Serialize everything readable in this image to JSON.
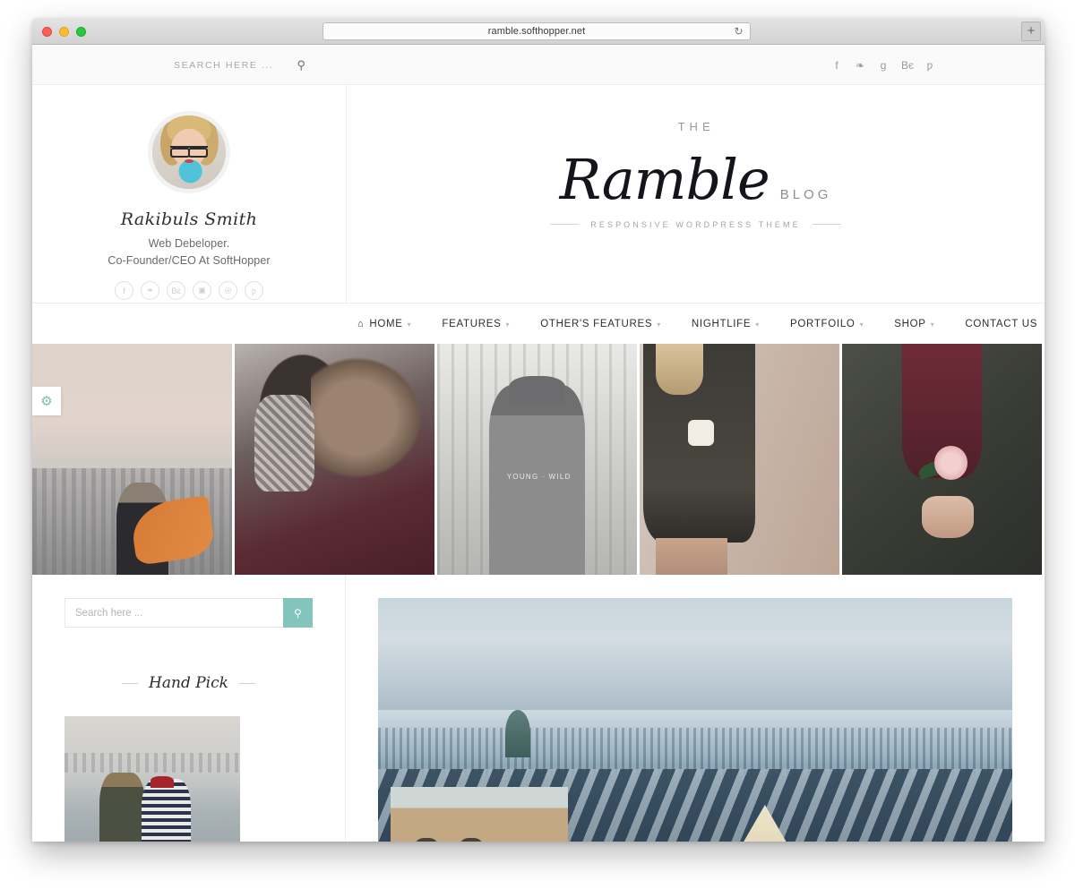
{
  "browser": {
    "url": "ramble.softhopper.net",
    "reload_icon": "reload-icon",
    "newtab_label": "+"
  },
  "topbar": {
    "search_placeholder": "SEARCH HERE ...",
    "search_icon": "search-icon",
    "social": [
      {
        "name": "facebook",
        "glyph": "f"
      },
      {
        "name": "twitter",
        "glyph": "❧"
      },
      {
        "name": "google-plus",
        "glyph": "g"
      },
      {
        "name": "behance",
        "glyph": "Bє"
      },
      {
        "name": "pinterest",
        "glyph": "ƿ"
      }
    ]
  },
  "profile": {
    "name": "Rakibuls Smith",
    "role_line1": "Web Debeloper.",
    "role_line2": "Co-Founder/CEO At SoftHopper",
    "social": [
      {
        "name": "facebook",
        "glyph": "f"
      },
      {
        "name": "twitter",
        "glyph": "❧"
      },
      {
        "name": "behance",
        "glyph": "Bє"
      },
      {
        "name": "instagram",
        "glyph": "▣"
      },
      {
        "name": "dribbble",
        "glyph": "◎"
      },
      {
        "name": "pinterest",
        "glyph": "ƿ"
      }
    ]
  },
  "brand": {
    "pre": "THE",
    "name": "Ramble",
    "post": "BLOG",
    "tagline": "RESPONSIVE WORDPRESS THEME"
  },
  "nav": {
    "items": [
      {
        "label": "HOME",
        "icon": "home-icon",
        "caret": "▾"
      },
      {
        "label": "FEATURES",
        "caret": "▾"
      },
      {
        "label": "OTHER'S FEATURES",
        "caret": "▾"
      },
      {
        "label": "NIGHTLIFE",
        "caret": "▾"
      },
      {
        "label": "PORTFOILO",
        "caret": "▾"
      },
      {
        "label": "SHOP",
        "caret": "▾"
      },
      {
        "label": "CONTACT US",
        "caret": ""
      }
    ]
  },
  "settings_toggle": {
    "icon": "gear-icon",
    "glyph": "⚙"
  },
  "gallery": {
    "items": [
      {
        "name": "woman-with-orange-scarf-overlooking-city",
        "alt": "Woman with orange scarf above a hazy skyline"
      },
      {
        "name": "couple-hugging-in-winter",
        "alt": "Couple embracing in winter coats"
      },
      {
        "name": "woman-in-beanie-and-young-wild-sweater",
        "alt": "Woman in grey beanie in a forest"
      },
      {
        "name": "woman-holding-coffee-cup",
        "alt": "Woman in knit dress holding a cup by a brick wall"
      },
      {
        "name": "hands-holding-pink-rose",
        "alt": "Hands holding a pink rose"
      }
    ],
    "overlay_text_g3": "YOUNG · WILD"
  },
  "sidebar": {
    "search": {
      "placeholder": "Search here ...",
      "value": "",
      "button_icon": "search-icon"
    },
    "handpick": {
      "title": "Hand Pick",
      "thumb_alt": "Couple sitting on a pier with a city skyline"
    }
  },
  "main": {
    "featured": {
      "name": "snowy-city-rooftops",
      "alt": "Winter cityscape with snow covered rooftops"
    }
  },
  "colors": {
    "accent_teal": "#83c5bd",
    "text_dark": "#2e2e2e",
    "muted": "#a8a8a8",
    "border": "#ededed"
  }
}
